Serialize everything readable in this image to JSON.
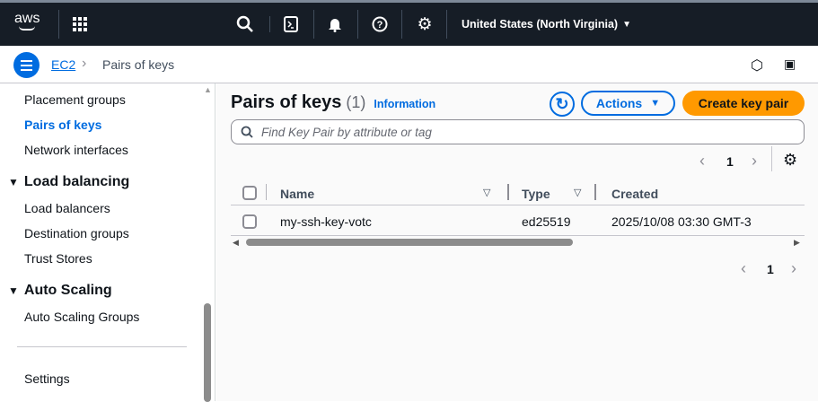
{
  "header": {
    "logo": "aws",
    "region": "United States (North Virginia)"
  },
  "breadcrumb": {
    "root": "EC2",
    "current": "Pairs of keys"
  },
  "sidebar": {
    "items_top": [
      "Placement groups",
      "Pairs of keys",
      "Network interfaces"
    ],
    "load_balancing": {
      "title": "Load balancing",
      "items": [
        "Load balancers",
        "Destination groups",
        "Trust Stores"
      ]
    },
    "auto_scaling": {
      "title": "Auto Scaling",
      "items": [
        "Auto Scaling Groups"
      ]
    },
    "settings": "Settings"
  },
  "main": {
    "title": "Pairs of keys",
    "count": "(1)",
    "info": "Information",
    "actions": "Actions",
    "create": "Create key pair",
    "search_placeholder": "Find Key Pair by attribute or tag",
    "page": "1",
    "columns": [
      "Name",
      "Type",
      "Created"
    ],
    "rows": [
      {
        "name": "my-ssh-key-votc",
        "type": "ed25519",
        "created": "2025/10/08 03:30 GMT-3"
      }
    ]
  },
  "colors": {
    "header": "#161d26",
    "accent": "#006ce0",
    "primary": "#ff9900"
  }
}
